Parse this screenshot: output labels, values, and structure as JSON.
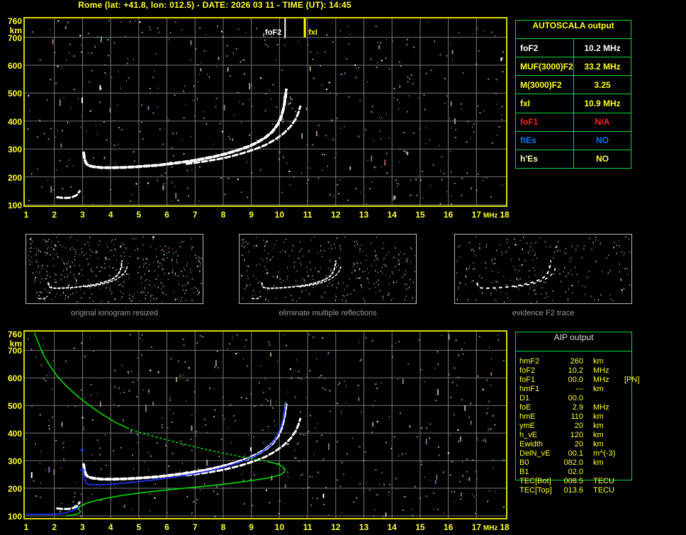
{
  "header": {
    "title": "Rome (lat: +41.8, lon: 012.5) - DATE: 2026 03 11 - TIME (UT): 14:45"
  },
  "colors": {
    "title_yellow": "#ffff33",
    "plot_border_yellow": "#d9d900",
    "grid_gray": "#777777",
    "table_border_green": "#00dd44",
    "trace_white": "#ffffff",
    "trace_blue": "#2233ee",
    "profile_green": "#00d800",
    "caption_gray": "#9a9a9a",
    "aip_text_yellow": "#ffff30",
    "aip_header_gray": "#dcdcdc",
    "fof1_red": "#ff2222",
    "ftes_blue": "#0077ff"
  },
  "autoscala_table": {
    "header": "AUTOSCALA output",
    "rows": [
      {
        "label": "foF2",
        "value": "10.2 MHz",
        "color": "#ffffff"
      },
      {
        "label": "MUF(3000)F2",
        "value": "33.2 MHz",
        "color": "#ffff22"
      },
      {
        "label": "M(3000)F2",
        "value": "3.25",
        "color": "#ffff22"
      },
      {
        "label": "fxI",
        "value": "10.9 MHz",
        "color": "#ffff22"
      },
      {
        "label": "foF1",
        "value": "N/A",
        "color": "#ff2222"
      },
      {
        "label": "ftEs",
        "value": "NO",
        "color": "#0077ff"
      },
      {
        "label": "h'Es",
        "value": "NO",
        "color": "#ffffb0",
        "value_color": "#ffff33"
      }
    ]
  },
  "aip_table": {
    "header": "AIP output",
    "rows": [
      [
        "hmF2",
        "260",
        "km",
        ""
      ],
      [
        "foF2",
        "10.2",
        "MHz",
        ""
      ],
      [
        "foF1",
        "00.0",
        "MHz",
        "[PN]"
      ],
      [
        "hmF1",
        "---",
        "km",
        ""
      ],
      [
        "D1",
        "00.0",
        "",
        ""
      ],
      [
        "foE",
        "2.9",
        "MHz",
        ""
      ],
      [
        "hmE",
        "110",
        "km",
        ""
      ],
      [
        "ymE",
        "20",
        "km",
        ""
      ],
      [
        "h_vE",
        "120",
        "km",
        ""
      ],
      [
        "Ewidth",
        "20",
        "km",
        ""
      ],
      [
        "DelN_vE",
        "00.1",
        "m^(-3)",
        ""
      ],
      [
        "B0",
        "082.0",
        "km",
        ""
      ],
      [
        "B1",
        "02.0",
        "",
        ""
      ],
      [
        "TEC[Bot]",
        "008.5",
        "TECU",
        ""
      ],
      [
        "TEC[Top]",
        "013.6",
        "TECU",
        ""
      ]
    ]
  },
  "thumbnails": [
    {
      "caption": "original ionogram resized"
    },
    {
      "caption": "eliminate multiple reflections"
    },
    {
      "caption": "evidence F2 trace"
    }
  ],
  "chart_data": [
    {
      "type": "scatter",
      "title": "recorded ionogram with AUTOSCALA frequency markers",
      "xlabel": "MHz",
      "ylabel": "km",
      "xlim": [
        1,
        18
      ],
      "ylim": [
        100,
        760
      ],
      "grid": true,
      "x_ticks": [
        1,
        2,
        3,
        4,
        5,
        6,
        7,
        8,
        9,
        10,
        11,
        12,
        13,
        14,
        15,
        16,
        17,
        18
      ],
      "y_ticks": [
        760,
        700,
        600,
        500,
        400,
        300,
        200,
        100
      ],
      "markers": [
        {
          "x": 10.2,
          "label": "foF2",
          "color": "#ffffff",
          "side": "left"
        },
        {
          "x": 10.9,
          "label": "fxI",
          "color": "#ffff00",
          "side": "right"
        }
      ],
      "series": [
        {
          "name": "Es-trace",
          "color": "#ffffff",
          "style": "dash",
          "width": 3,
          "points": [
            [
              2.1,
              127
            ],
            [
              2.3,
              125
            ],
            [
              2.5,
              125
            ],
            [
              2.65,
              128
            ],
            [
              2.8,
              135
            ],
            [
              2.9,
              149
            ]
          ]
        },
        {
          "name": "F2-O-trace",
          "color": "#ffffff",
          "style": "dash",
          "width": 4,
          "points": [
            [
              3.04,
              286
            ],
            [
              3.07,
              266
            ],
            [
              3.12,
              250
            ],
            [
              3.2,
              241
            ],
            [
              3.4,
              236
            ],
            [
              3.7,
              233
            ],
            [
              4.1,
              233
            ],
            [
              4.5,
              234
            ],
            [
              4.9,
              236
            ],
            [
              5.3,
              239
            ],
            [
              5.7,
              242
            ],
            [
              6.1,
              247
            ],
            [
              6.5,
              252
            ],
            [
              6.9,
              258
            ],
            [
              7.3,
              265
            ],
            [
              7.7,
              273
            ],
            [
              8.1,
              283
            ],
            [
              8.5,
              295
            ],
            [
              8.9,
              309
            ],
            [
              9.2,
              323
            ],
            [
              9.5,
              341
            ],
            [
              9.75,
              362
            ],
            [
              9.95,
              390
            ],
            [
              10.08,
              420
            ],
            [
              10.16,
              452
            ],
            [
              10.21,
              484
            ],
            [
              10.24,
              512
            ]
          ]
        },
        {
          "name": "F2-X-trace",
          "color": "#ffffff",
          "style": "dash",
          "width": 3,
          "points": [
            [
              6.7,
              247
            ],
            [
              7.1,
              252
            ],
            [
              7.5,
              258
            ],
            [
              7.9,
              265
            ],
            [
              8.3,
              274
            ],
            [
              8.7,
              285
            ],
            [
              9.1,
              298
            ],
            [
              9.5,
              314
            ],
            [
              9.85,
              334
            ],
            [
              10.15,
              356
            ],
            [
              10.4,
              381
            ],
            [
              10.58,
              408
            ],
            [
              10.68,
              432
            ],
            [
              10.74,
              452
            ]
          ]
        }
      ]
    },
    {
      "type": "scatter",
      "title": "ionogram with restored trace and electron density profile",
      "xlabel": "MHz",
      "ylabel": "km",
      "xlim": [
        1,
        18
      ],
      "ylim": [
        100,
        760
      ],
      "grid": true,
      "markers": [],
      "x_ticks": [
        1,
        2,
        3,
        4,
        5,
        6,
        7,
        8,
        9,
        10,
        11,
        12,
        13,
        14,
        15,
        16,
        17,
        18
      ],
      "y_ticks": [
        760,
        700,
        600,
        500,
        400,
        300,
        200,
        100
      ],
      "series": [
        {
          "name": "Es-trace",
          "color": "#ffffff",
          "style": "dash",
          "width": 3,
          "points": [
            [
              2.1,
              127
            ],
            [
              2.3,
              125
            ],
            [
              2.5,
              125
            ],
            [
              2.65,
              128
            ],
            [
              2.8,
              135
            ],
            [
              2.9,
              149
            ]
          ]
        },
        {
          "name": "F2-O-trace",
          "color": "#ffffff",
          "style": "dash",
          "width": 4,
          "points": [
            [
              3.04,
              286
            ],
            [
              3.07,
              266
            ],
            [
              3.12,
              250
            ],
            [
              3.2,
              241
            ],
            [
              3.4,
              236
            ],
            [
              3.7,
              233
            ],
            [
              4.1,
              233
            ],
            [
              4.5,
              234
            ],
            [
              4.9,
              236
            ],
            [
              5.3,
              239
            ],
            [
              5.7,
              242
            ],
            [
              6.1,
              247
            ],
            [
              6.5,
              252
            ],
            [
              6.9,
              258
            ],
            [
              7.3,
              265
            ],
            [
              7.7,
              273
            ],
            [
              8.1,
              283
            ],
            [
              8.5,
              295
            ],
            [
              8.9,
              309
            ],
            [
              9.2,
              323
            ],
            [
              9.5,
              341
            ],
            [
              9.75,
              362
            ],
            [
              9.95,
              390
            ],
            [
              10.08,
              420
            ],
            [
              10.16,
              452
            ],
            [
              10.21,
              484
            ],
            [
              10.24,
              512
            ]
          ]
        },
        {
          "name": "F2-X-trace",
          "color": "#ffffff",
          "style": "dash",
          "width": 3,
          "points": [
            [
              6.7,
              247
            ],
            [
              7.1,
              252
            ],
            [
              7.5,
              258
            ],
            [
              7.9,
              265
            ],
            [
              8.3,
              274
            ],
            [
              8.7,
              285
            ],
            [
              9.1,
              298
            ],
            [
              9.5,
              314
            ],
            [
              9.85,
              334
            ],
            [
              10.15,
              356
            ],
            [
              10.4,
              381
            ],
            [
              10.58,
              408
            ],
            [
              10.68,
              432
            ],
            [
              10.74,
              452
            ]
          ]
        },
        {
          "name": "restored-E-trace",
          "color": "#2233ee",
          "style": "dense",
          "width": 2,
          "points": [
            [
              1.0,
              106
            ],
            [
              1.5,
              106
            ],
            [
              2.0,
              106
            ],
            [
              2.25,
              108
            ],
            [
              2.45,
              112
            ],
            [
              2.6,
              117
            ],
            [
              2.72,
              122
            ],
            [
              2.82,
              128
            ],
            [
              2.9,
              135
            ]
          ]
        },
        {
          "name": "restored-F-trace",
          "color": "#2233ee",
          "style": "dense",
          "width": 2,
          "points": [
            [
              3.02,
              270
            ],
            [
              3.06,
              242
            ],
            [
              3.1,
              222
            ],
            [
              3.2,
              214
            ],
            [
              3.5,
              212
            ],
            [
              3.9,
              214
            ],
            [
              4.3,
              217
            ],
            [
              4.7,
              221
            ],
            [
              5.1,
              225
            ],
            [
              5.5,
              230
            ],
            [
              5.9,
              235
            ],
            [
              6.3,
              241
            ],
            [
              6.7,
              248
            ],
            [
              7.1,
              255
            ],
            [
              7.5,
              263
            ],
            [
              7.9,
              273
            ],
            [
              8.3,
              285
            ],
            [
              8.7,
              299
            ],
            [
              9.1,
              316
            ],
            [
              9.4,
              333
            ],
            [
              9.7,
              357
            ],
            [
              9.9,
              386
            ],
            [
              10.05,
              421
            ],
            [
              10.15,
              458
            ],
            [
              10.2,
              492
            ],
            [
              10.22,
              512
            ]
          ]
        },
        {
          "name": "restored-isolated-marks",
          "color": "#2233ee",
          "style": "marks",
          "width": 2,
          "points": [
            [
              2.98,
              338
            ],
            [
              2.99,
              268
            ]
          ]
        },
        {
          "name": "profile-topside-solid",
          "color": "#00d800",
          "style": "solid",
          "width": 1.6,
          "points": [
            [
              1.3,
              762
            ],
            [
              1.45,
              722
            ],
            [
              1.62,
              682
            ],
            [
              1.85,
              642
            ],
            [
              2.12,
              604
            ],
            [
              2.45,
              568
            ],
            [
              2.82,
              534
            ],
            [
              3.25,
              500
            ],
            [
              3.7,
              468
            ],
            [
              4.15,
              440
            ],
            [
              4.6,
              418
            ]
          ]
        },
        {
          "name": "profile-topside-dotted",
          "color": "#00d800",
          "style": "dot",
          "width": 1.6,
          "points": [
            [
              4.6,
              418
            ],
            [
              5.1,
              400
            ],
            [
              5.6,
              386
            ],
            [
              6.2,
              370
            ],
            [
              6.8,
              355
            ],
            [
              7.4,
              340
            ],
            [
              8.0,
              327
            ],
            [
              8.6,
              315
            ],
            [
              9.2,
              304
            ],
            [
              9.65,
              295
            ]
          ]
        },
        {
          "name": "profile-bottomside",
          "color": "#00d800",
          "style": "solid",
          "width": 1.6,
          "points": [
            [
              9.65,
              295
            ],
            [
              9.95,
              287
            ],
            [
              10.12,
              278
            ],
            [
              10.2,
              268
            ],
            [
              10.16,
              257
            ],
            [
              10.0,
              248
            ],
            [
              9.62,
              238
            ],
            [
              9.0,
              228
            ],
            [
              8.3,
              218
            ],
            [
              7.5,
              209
            ],
            [
              6.7,
              201
            ],
            [
              5.9,
              193
            ],
            [
              5.1,
              184
            ],
            [
              4.4,
              174
            ],
            [
              3.9,
              165
            ],
            [
              3.5,
              156
            ],
            [
              3.2,
              148
            ],
            [
              3.0,
              140
            ],
            [
              2.9,
              133
            ],
            [
              2.84,
              127
            ]
          ]
        },
        {
          "name": "profile-E-hook",
          "color": "#00d800",
          "style": "solid",
          "width": 1.6,
          "points": [
            [
              2.84,
              127
            ],
            [
              2.9,
              121
            ],
            [
              2.93,
              115
            ],
            [
              2.87,
              109
            ],
            [
              2.72,
              104
            ],
            [
              2.55,
              102
            ],
            [
              2.42,
              101
            ]
          ]
        }
      ]
    }
  ]
}
